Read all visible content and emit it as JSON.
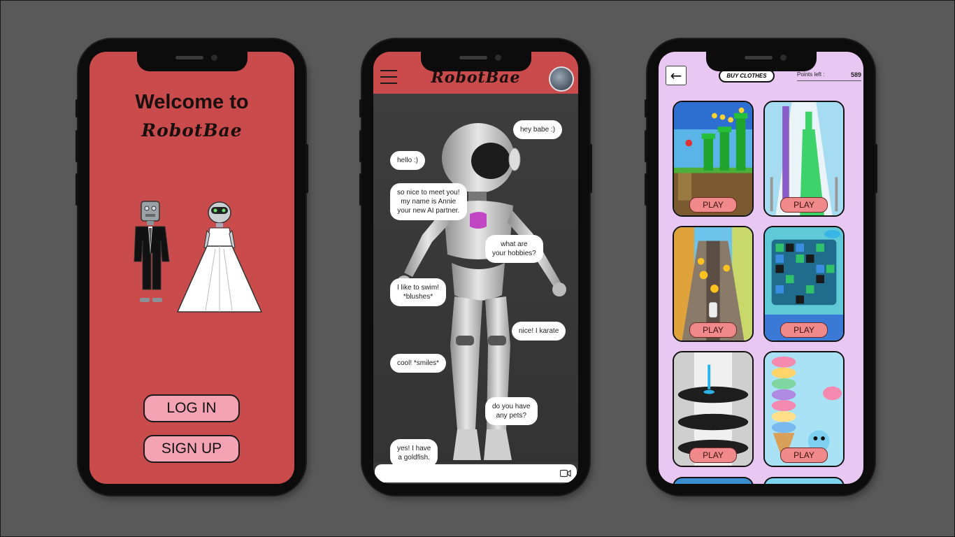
{
  "login_screen": {
    "welcome_text": "Welcome to",
    "brand": "RobotBae",
    "login_label": "LOG IN",
    "signup_label": "SIGN UP"
  },
  "chat_screen": {
    "brand": "RobotBae",
    "menu_icon": "hamburger-icon",
    "avatar_icon": "user-avatar",
    "video_icon": "video-camera-icon",
    "messages": [
      {
        "side": "right",
        "text": "hey babe :)"
      },
      {
        "side": "left",
        "text": "hello :)"
      },
      {
        "side": "left",
        "text": "so nice to meet you!\nmy name is Annie\nyour new AI partner."
      },
      {
        "side": "right",
        "text": "what are\nyour hobbies?"
      },
      {
        "side": "left",
        "text": "I like to swim!\n*blushes*"
      },
      {
        "side": "right",
        "text": "nice! I karate"
      },
      {
        "side": "left",
        "text": "cool! *smiles*"
      },
      {
        "side": "right",
        "text": "do you have\nany pets?"
      },
      {
        "side": "left",
        "text": "yes! I have\na goldfish."
      }
    ]
  },
  "games_screen": {
    "back_icon": "arrow-left-icon",
    "buy_label": "BUY CLOTHES",
    "points_label": "Points left :",
    "points_value": "589",
    "play_label": "PLAY",
    "games": [
      {
        "id": "platformer"
      },
      {
        "id": "runner-stack"
      },
      {
        "id": "subway-runner"
      },
      {
        "id": "match-puzzle"
      },
      {
        "id": "helix-tower"
      },
      {
        "id": "ice-cream-stack"
      }
    ]
  },
  "colors": {
    "background": "#595959",
    "brand_red": "#c94b4b",
    "button_pink": "#f4a3b4",
    "games_bg": "#e8c8f2",
    "play_button": "#f08a8a"
  }
}
